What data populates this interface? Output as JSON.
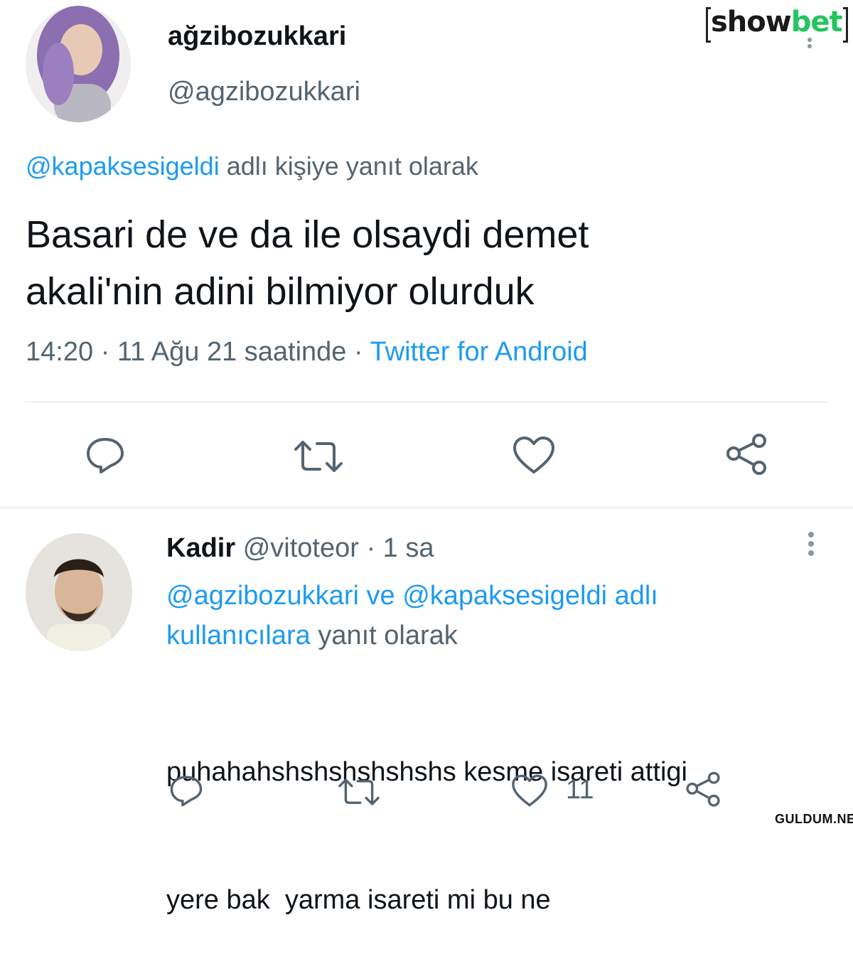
{
  "tweet": {
    "display_name": "ağzibozukkari",
    "handle": "@agzibozukkari",
    "reply_to_handle": "@kapaksesigeldi",
    "reply_to_suffix": "adlı kişiye yanıt olarak",
    "text_line1": "Basari de ve da ile olsaydi demet",
    "text_line2": "akali'nin adini bilmiyor olurduk",
    "timestamp": "14:20 · 11 Ağu 21 saatinde ·",
    "source": "Twitter for Android"
  },
  "reply": {
    "display_name": "Kadir",
    "handle": "@vitoteor",
    "time": "· 1 sa",
    "reply_line1_user1": "@agzibozukkari",
    "reply_line1_and": "ve",
    "reply_line1_user2": "@kapaksesigeldi adlı",
    "reply_line2_link": "kullanıcılara",
    "reply_line2_suffix": "yanıt olarak",
    "text_line1": "puhahahshshshshshshs kesme isareti attigi",
    "text_line2": "yere bak  yarma isareti mi bu ne",
    "like_count": "11"
  },
  "watermarks": {
    "logo_show": "show",
    "logo_bet": "bet",
    "site": "GULDUM.NET"
  },
  "colors": {
    "accent": "#1d9bf0",
    "icon_gray": "#536471",
    "logo_green": "#22c55e"
  },
  "icons": [
    "reply-icon",
    "retweet-icon",
    "like-icon",
    "share-icon",
    "more-icon"
  ]
}
